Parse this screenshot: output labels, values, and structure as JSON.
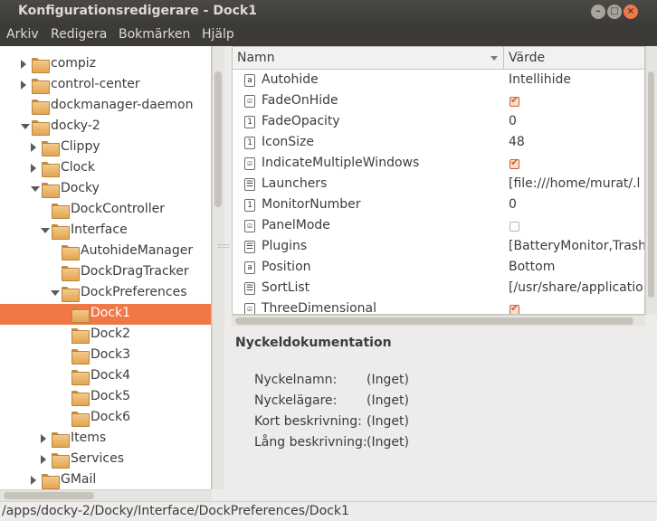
{
  "window": {
    "title": "Konfigurationsredigerare - Dock1",
    "minimize_glyph": "–",
    "maximize_glyph": "□",
    "close_glyph": "×"
  },
  "menubar": {
    "items": [
      "Arkiv",
      "Redigera",
      "Bokmärken",
      "Hjälp"
    ]
  },
  "tree": {
    "items": [
      {
        "label": "compiz",
        "depth": 0,
        "state": "collapsed"
      },
      {
        "label": "control-center",
        "depth": 0,
        "state": "collapsed"
      },
      {
        "label": "dockmanager-daemon",
        "depth": 0,
        "state": "none"
      },
      {
        "label": "docky-2",
        "depth": 0,
        "state": "expanded"
      },
      {
        "label": "Clippy",
        "depth": 1,
        "state": "collapsed"
      },
      {
        "label": "Clock",
        "depth": 1,
        "state": "collapsed"
      },
      {
        "label": "Docky",
        "depth": 1,
        "state": "expanded"
      },
      {
        "label": "DockController",
        "depth": 2,
        "state": "none"
      },
      {
        "label": "Interface",
        "depth": 2,
        "state": "expanded"
      },
      {
        "label": "AutohideManager",
        "depth": 3,
        "state": "none"
      },
      {
        "label": "DockDragTracker",
        "depth": 3,
        "state": "none"
      },
      {
        "label": "DockPreferences",
        "depth": 3,
        "state": "expanded"
      },
      {
        "label": "Dock1",
        "depth": 4,
        "state": "none",
        "selected": true
      },
      {
        "label": "Dock2",
        "depth": 4,
        "state": "none"
      },
      {
        "label": "Dock3",
        "depth": 4,
        "state": "none"
      },
      {
        "label": "Dock4",
        "depth": 4,
        "state": "none"
      },
      {
        "label": "Dock5",
        "depth": 4,
        "state": "none"
      },
      {
        "label": "Dock6",
        "depth": 4,
        "state": "none"
      },
      {
        "label": "Items",
        "depth": 2,
        "state": "collapsed"
      },
      {
        "label": "Services",
        "depth": 2,
        "state": "collapsed"
      },
      {
        "label": "GMail",
        "depth": 1,
        "state": "collapsed"
      }
    ]
  },
  "keys": {
    "headers": {
      "name": "Namn",
      "value": "Värde"
    },
    "rows": [
      {
        "name": "Autohide",
        "type": "string",
        "value": "Intellihide"
      },
      {
        "name": "FadeOnHide",
        "type": "bool",
        "checked": true
      },
      {
        "name": "FadeOpacity",
        "type": "number",
        "value": "0"
      },
      {
        "name": "IconSize",
        "type": "number",
        "value": "48"
      },
      {
        "name": "IndicateMultipleWindows",
        "type": "bool",
        "checked": true
      },
      {
        "name": "Launchers",
        "type": "list",
        "value": "[file:///home/murat/.l"
      },
      {
        "name": "MonitorNumber",
        "type": "number",
        "value": "0"
      },
      {
        "name": "PanelMode",
        "type": "bool",
        "checked": false
      },
      {
        "name": "Plugins",
        "type": "list",
        "value": "[BatteryMonitor,Trash"
      },
      {
        "name": "Position",
        "type": "string",
        "value": "Bottom"
      },
      {
        "name": "SortList",
        "type": "list",
        "value": "[/usr/share/applicatio"
      },
      {
        "name": "ThreeDimensional",
        "type": "bool",
        "checked": true
      }
    ],
    "type_glyphs": {
      "string": "a",
      "number": "1",
      "bool": "☑",
      "list": "☰"
    }
  },
  "docs": {
    "title": "Nyckeldokumentation",
    "fields": [
      {
        "label": "Nyckelnamn:",
        "value": "(Inget)"
      },
      {
        "label": "Nyckelägare:",
        "value": "(Inget)"
      },
      {
        "label": "Kort beskrivning:",
        "value": "(Inget)"
      },
      {
        "label": "Lång beskrivning:",
        "value": "(Inget)"
      }
    ]
  },
  "statusbar": {
    "path": "/apps/docky-2/Docky/Interface/DockPreferences/Dock1"
  },
  "colors": {
    "accent": "#f07746",
    "titlebar": "#3c3b37"
  }
}
